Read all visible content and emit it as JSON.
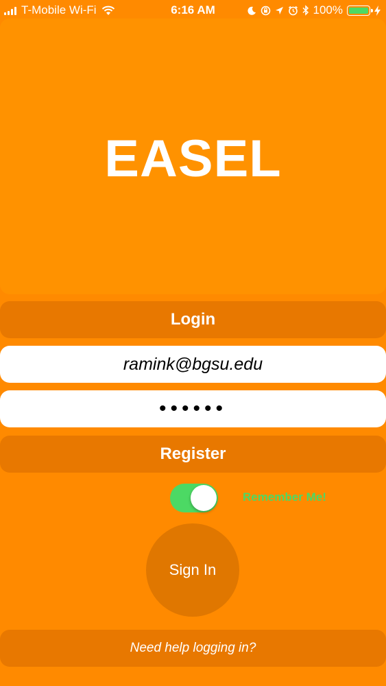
{
  "status_bar": {
    "carrier": "T-Mobile Wi-Fi",
    "time": "6:16 AM",
    "battery_percent": "100%",
    "battery_level": 1.0,
    "icons": [
      "signal-icon",
      "wifi-icon",
      "moon-icon",
      "rotation-lock-icon",
      "location-icon",
      "alarm-icon",
      "bluetooth-icon",
      "battery-icon",
      "charging-icon"
    ]
  },
  "header": {
    "title": "EASEL"
  },
  "login_label": "Login",
  "email": {
    "value": "ramink@bgsu.edu"
  },
  "password": {
    "masked_value": "••••••"
  },
  "register_label": "Register",
  "remember_me": {
    "label": "Remember Me!",
    "on": true
  },
  "sign_in_label": "Sign In",
  "help_link": "Need help logging in?",
  "colors": {
    "background": "#ff8a00",
    "panel": "#ff9200",
    "bar": "#e87800",
    "toggle_on": "#4cd964"
  }
}
